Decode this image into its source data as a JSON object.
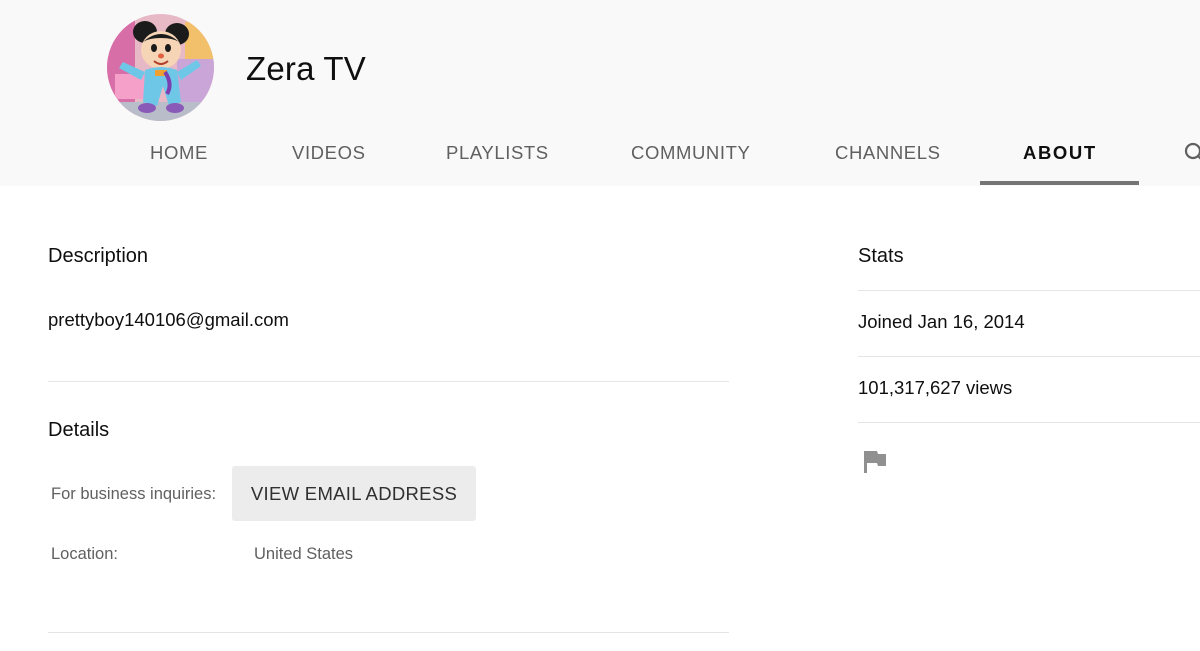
{
  "channel": {
    "name": "Zera TV",
    "avatar_icon": "cartoon-mouse-avatar"
  },
  "tabs": [
    {
      "label": "HOME",
      "active": false
    },
    {
      "label": "VIDEOS",
      "active": false
    },
    {
      "label": "PLAYLISTS",
      "active": false
    },
    {
      "label": "COMMUNITY",
      "active": false
    },
    {
      "label": "CHANNELS",
      "active": false
    },
    {
      "label": "ABOUT",
      "active": true
    }
  ],
  "tab_search_icon": "search-icon",
  "description": {
    "title": "Description",
    "text": "prettyboy140106@gmail.com"
  },
  "details": {
    "title": "Details",
    "business_label": "For business inquiries:",
    "email_button_label": "VIEW EMAIL ADDRESS",
    "location_label": "Location:",
    "location_value": "United States"
  },
  "stats": {
    "title": "Stats",
    "joined": "Joined Jan 16, 2014",
    "views": "101,317,627 views",
    "report_icon": "flag-icon"
  },
  "colors": {
    "header_bg": "#f9f9f9",
    "tab_inactive": "#606060",
    "tab_active": "#0f0f0f",
    "tab_underline": "#757575",
    "button_bg": "#ececec",
    "divider": "#e5e5e5"
  }
}
